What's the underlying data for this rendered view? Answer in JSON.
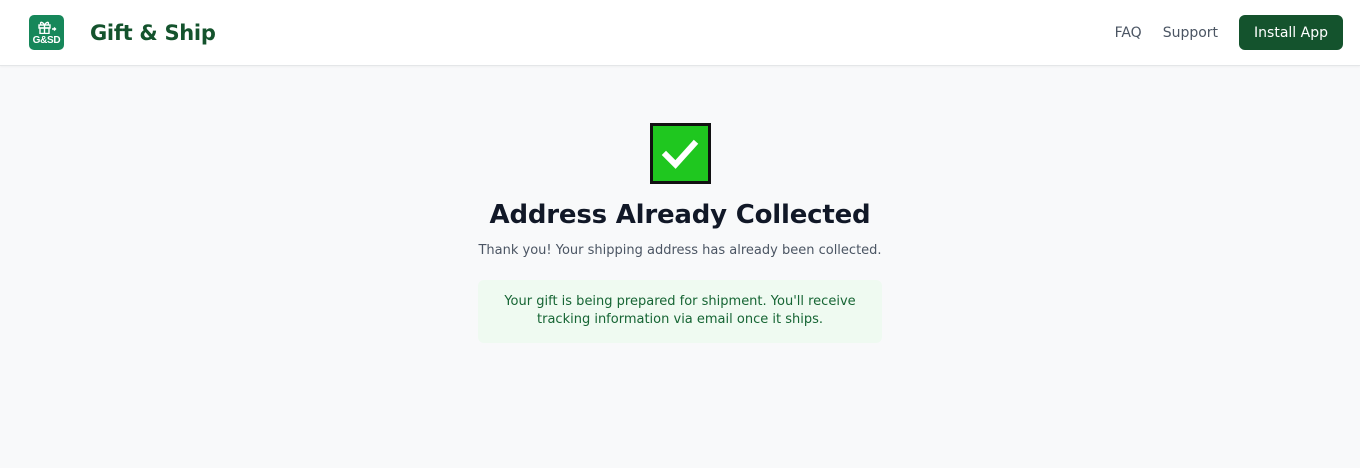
{
  "header": {
    "logo_text": "G&SD",
    "brand_name": "Gift & Ship",
    "nav": {
      "faq": "FAQ",
      "support": "Support",
      "install_label": "Install App"
    }
  },
  "main": {
    "title": "Address Already Collected",
    "subtitle": "Thank you! Your shipping address has already been collected.",
    "notice": "Your gift is being prepared for shipment. You'll receive tracking information via email once it ships."
  },
  "colors": {
    "brand_green": "#14532d",
    "logo_green": "#16875a",
    "check_green": "#1fc71f",
    "notice_bg": "#effaf1"
  },
  "icons": {
    "logo": "gift-icon",
    "status": "checkmark-icon"
  }
}
